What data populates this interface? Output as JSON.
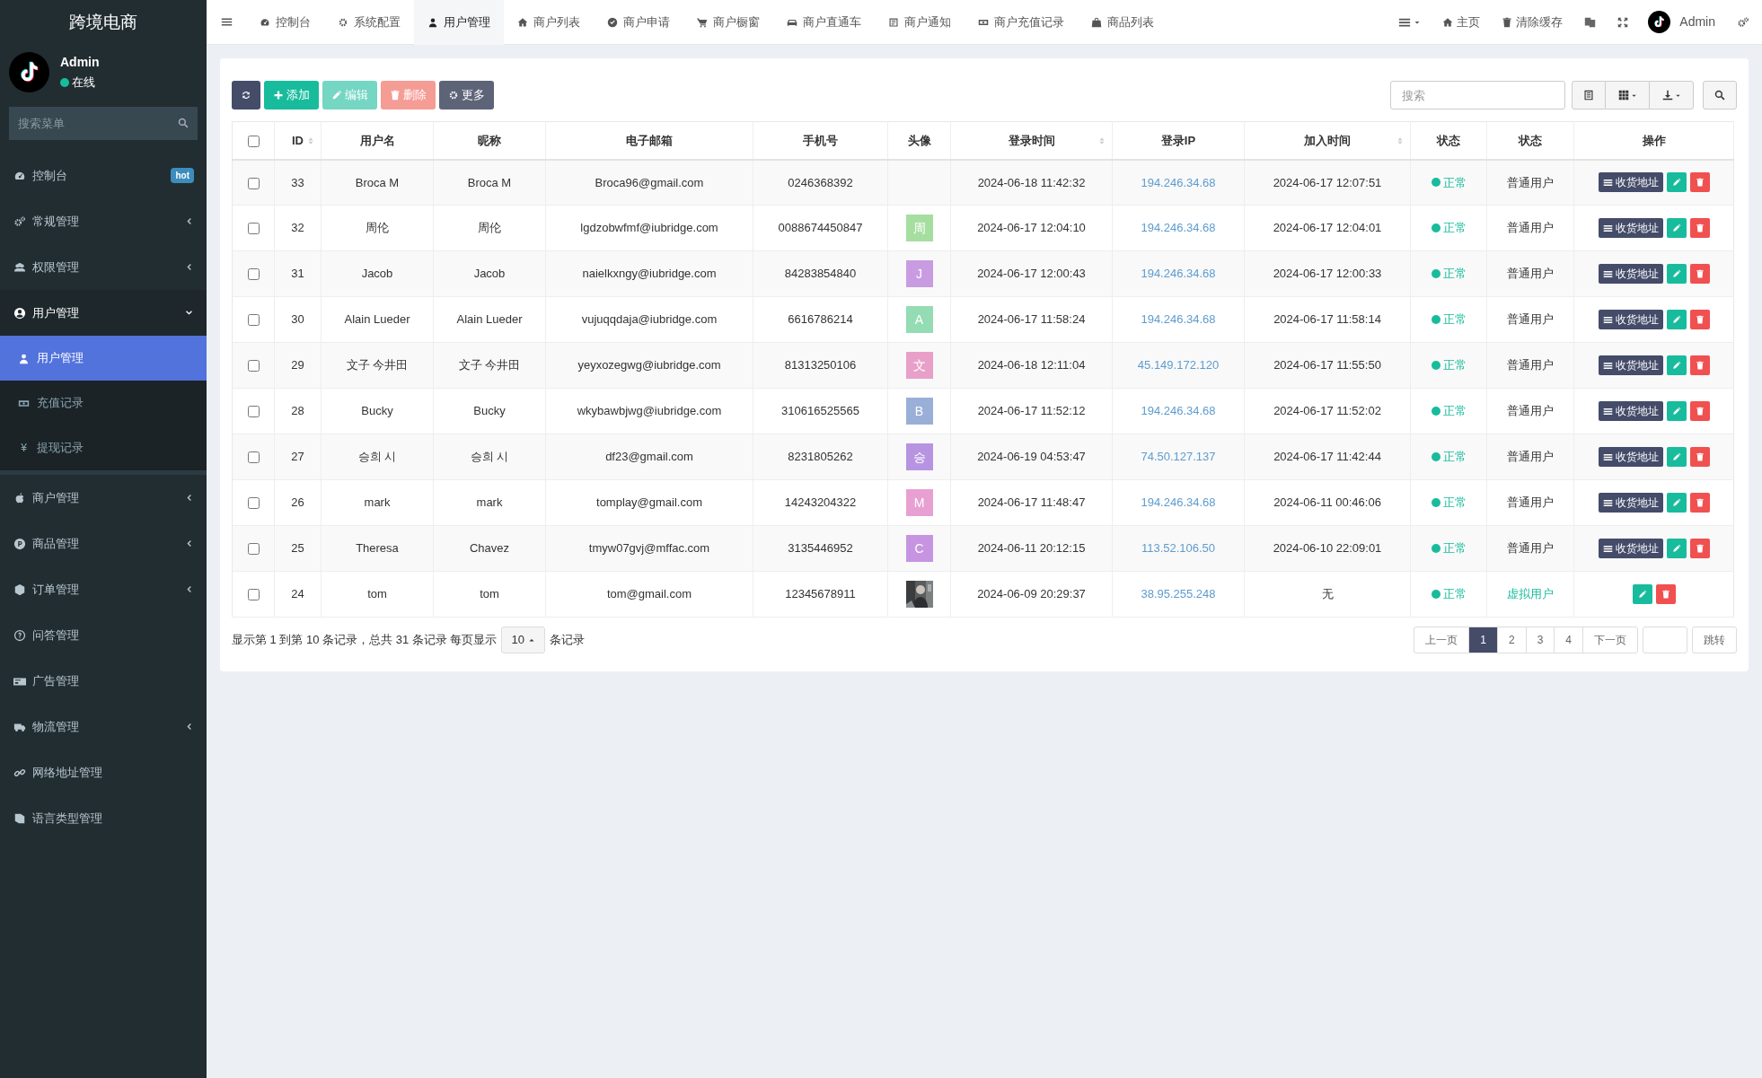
{
  "sidebar": {
    "brand": "跨境电商",
    "user": {
      "name": "Admin",
      "status": "在线"
    },
    "search": {
      "placeholder": "搜索菜单"
    },
    "items": [
      {
        "label": "控制台",
        "kind": "link",
        "badge": "hot",
        "expanded": false
      },
      {
        "label": "常规管理",
        "kind": "group",
        "expanded": false
      },
      {
        "label": "权限管理",
        "kind": "group",
        "expanded": false
      },
      {
        "label": "用户管理",
        "kind": "group",
        "expanded": true,
        "children": [
          {
            "label": "用户管理",
            "selected": true
          },
          {
            "label": "充值记录",
            "selected": false
          },
          {
            "label": "提现记录",
            "glyph": "¥",
            "selected": false
          }
        ]
      },
      {
        "label": "商户管理",
        "kind": "group",
        "expanded": false
      },
      {
        "label": "商品管理",
        "kind": "group",
        "expanded": false
      },
      {
        "label": "订单管理",
        "kind": "group",
        "expanded": false
      },
      {
        "label": "问答管理",
        "kind": "link",
        "expanded": false
      },
      {
        "label": "广告管理",
        "kind": "link",
        "expanded": false
      },
      {
        "label": "物流管理",
        "kind": "group",
        "expanded": false
      },
      {
        "label": "网络地址管理",
        "kind": "link",
        "expanded": false
      },
      {
        "label": "语言类型管理",
        "kind": "link",
        "expanded": false
      }
    ]
  },
  "tabs": [
    {
      "label": "控制台",
      "selected": false
    },
    {
      "label": "系统配置",
      "selected": false
    },
    {
      "label": "用户管理",
      "selected": true
    },
    {
      "label": "商户列表",
      "selected": false
    },
    {
      "label": "商户申请",
      "selected": false
    },
    {
      "label": "商户橱窗",
      "selected": false
    },
    {
      "label": "商户直通车",
      "selected": false
    },
    {
      "label": "商户通知",
      "selected": false
    },
    {
      "label": "商户充值记录",
      "selected": false
    },
    {
      "label": "商品列表",
      "selected": false
    }
  ],
  "top_right": {
    "home": "主页",
    "clear_cache": "清除缓存",
    "user": "Admin"
  },
  "toolbar": {
    "buttons": [
      {
        "kind": "refresh",
        "disabled": false
      },
      {
        "kind": "add",
        "label": "添加",
        "disabled": false
      },
      {
        "kind": "edit",
        "label": "编辑",
        "disabled": true
      },
      {
        "kind": "delete",
        "label": "删除",
        "disabled": true
      },
      {
        "kind": "more",
        "label": "更多",
        "disabled": false
      }
    ],
    "search": {
      "placeholder": "搜索"
    }
  },
  "table": {
    "select_all": {
      "checked": false
    },
    "columns": [
      {
        "label": "ID",
        "sortable": true
      },
      {
        "label": "用户名",
        "sortable": false
      },
      {
        "label": "昵称",
        "sortable": false
      },
      {
        "label": "电子邮箱",
        "sortable": false
      },
      {
        "label": "手机号",
        "sortable": false
      },
      {
        "label": "头像",
        "sortable": false
      },
      {
        "label": "登录时间",
        "sortable": true
      },
      {
        "label": "登录IP",
        "sortable": false
      },
      {
        "label": "加入时间",
        "sortable": true
      },
      {
        "label": "状态",
        "sortable": false
      },
      {
        "label": "状态",
        "sortable": false
      },
      {
        "label": "操作",
        "sortable": false
      }
    ],
    "rows": [
      {
        "checked": false,
        "id": "33",
        "username": "Broca M",
        "nickname": "Broca M",
        "email": "Broca96@gmail.com",
        "phone": "0246368392",
        "avatar": {
          "kind": "none"
        },
        "login_time": "2024-06-18 11:42:32",
        "login_ip": "194.246.34.68",
        "join_time": "2024-06-17 12:07:51",
        "status": "正常",
        "type": {
          "label": "普通用户",
          "kind": "normal"
        },
        "address_button": "收货地址"
      },
      {
        "checked": false,
        "id": "32",
        "username": "周伦",
        "nickname": "周伦",
        "email": "lgdzobwfmf@iubridge.com",
        "phone": "0088674450847",
        "avatar": {
          "kind": "letter",
          "letter": "周",
          "color": "#a6dea0"
        },
        "login_time": "2024-06-17 12:04:10",
        "login_ip": "194.246.34.68",
        "join_time": "2024-06-17 12:04:01",
        "status": "正常",
        "type": {
          "label": "普通用户",
          "kind": "normal"
        },
        "address_button": "收货地址"
      },
      {
        "checked": false,
        "id": "31",
        "username": "Jacob",
        "nickname": "Jacob",
        "email": "naielkxngy@iubridge.com",
        "phone": "84283854840",
        "avatar": {
          "kind": "letter",
          "letter": "J",
          "color": "#c99ce2"
        },
        "login_time": "2024-06-17 12:00:43",
        "login_ip": "194.246.34.68",
        "join_time": "2024-06-17 12:00:33",
        "status": "正常",
        "type": {
          "label": "普通用户",
          "kind": "normal"
        },
        "address_button": "收货地址"
      },
      {
        "checked": false,
        "id": "30",
        "username": "Alain Lueder",
        "nickname": "Alain Lueder",
        "email": "vujuqqdaja@iubridge.com",
        "phone": "6616786214",
        "avatar": {
          "kind": "letter",
          "letter": "A",
          "color": "#94dcb4"
        },
        "login_time": "2024-06-17 11:58:24",
        "login_ip": "194.246.34.68",
        "join_time": "2024-06-17 11:58:14",
        "status": "正常",
        "type": {
          "label": "普通用户",
          "kind": "normal"
        },
        "address_button": "收货地址"
      },
      {
        "checked": false,
        "id": "29",
        "username": "文子 今井田",
        "nickname": "文子 今井田",
        "email": "yeyxozegwg@iubridge.com",
        "phone": "81313250106",
        "avatar": {
          "kind": "letter",
          "letter": "文",
          "color": "#e8a0c8"
        },
        "login_time": "2024-06-18 12:11:04",
        "login_ip": "45.149.172.120",
        "join_time": "2024-06-17 11:55:50",
        "status": "正常",
        "type": {
          "label": "普通用户",
          "kind": "normal"
        },
        "address_button": "收货地址"
      },
      {
        "checked": false,
        "id": "28",
        "username": "Bucky",
        "nickname": "Bucky",
        "email": "wkybawbjwg@iubridge.com",
        "phone": "310616525565",
        "avatar": {
          "kind": "letter",
          "letter": "B",
          "color": "#9aafd8"
        },
        "login_time": "2024-06-17 11:52:12",
        "login_ip": "194.246.34.68",
        "join_time": "2024-06-17 11:52:02",
        "status": "正常",
        "type": {
          "label": "普通用户",
          "kind": "normal"
        },
        "address_button": "收货地址"
      },
      {
        "checked": false,
        "id": "27",
        "username": "승희 시",
        "nickname": "승희 시",
        "email": "df23@gmail.com",
        "phone": "8231805262",
        "avatar": {
          "kind": "letter",
          "letter": "승",
          "color": "#b794e2"
        },
        "login_time": "2024-06-19 04:53:47",
        "login_ip": "74.50.127.137",
        "join_time": "2024-06-17 11:42:44",
        "status": "正常",
        "type": {
          "label": "普通用户",
          "kind": "normal"
        },
        "address_button": "收货地址"
      },
      {
        "checked": false,
        "id": "26",
        "username": "mark",
        "nickname": "mark",
        "email": "tomplay@gmail.com",
        "phone": "14243204322",
        "avatar": {
          "kind": "letter",
          "letter": "M",
          "color": "#e8a0d2"
        },
        "login_time": "2024-06-17 11:48:47",
        "login_ip": "194.246.34.68",
        "join_time": "2024-06-11 00:46:06",
        "status": "正常",
        "type": {
          "label": "普通用户",
          "kind": "normal"
        },
        "address_button": "收货地址"
      },
      {
        "checked": false,
        "id": "25",
        "username": "Theresa",
        "nickname": "Chavez",
        "email": "tmyw07gvj@mffac.com",
        "phone": "3135446952",
        "avatar": {
          "kind": "letter",
          "letter": "C",
          "color": "#c794e2"
        },
        "login_time": "2024-06-11 20:12:15",
        "login_ip": "113.52.106.50",
        "join_time": "2024-06-10 22:09:01",
        "status": "正常",
        "type": {
          "label": "普通用户",
          "kind": "normal"
        },
        "address_button": "收货地址"
      },
      {
        "checked": false,
        "id": "24",
        "username": "tom",
        "nickname": "tom",
        "email": "tom@gmail.com",
        "phone": "12345678911",
        "login_time": "2024-06-09 20:29:37",
        "login_ip": "38.95.255.248",
        "join_time": "无",
        "status": "正常",
        "type": {
          "label": "虚拟用户",
          "kind": "virtual"
        }
      }
    ]
  },
  "footer": {
    "summary": "显示第 1 到第 10 条记录，总共 31 条记录 每页显示",
    "page_size": "10",
    "suffix": "条记录",
    "pagination": [
      {
        "label": "上一页",
        "selected": false
      },
      {
        "label": "1",
        "selected": true
      },
      {
        "label": "2",
        "selected": false
      },
      {
        "label": "3",
        "selected": false
      },
      {
        "label": "4",
        "selected": false
      },
      {
        "label": "下一页",
        "selected": false
      }
    ],
    "jump": "跳转"
  }
}
